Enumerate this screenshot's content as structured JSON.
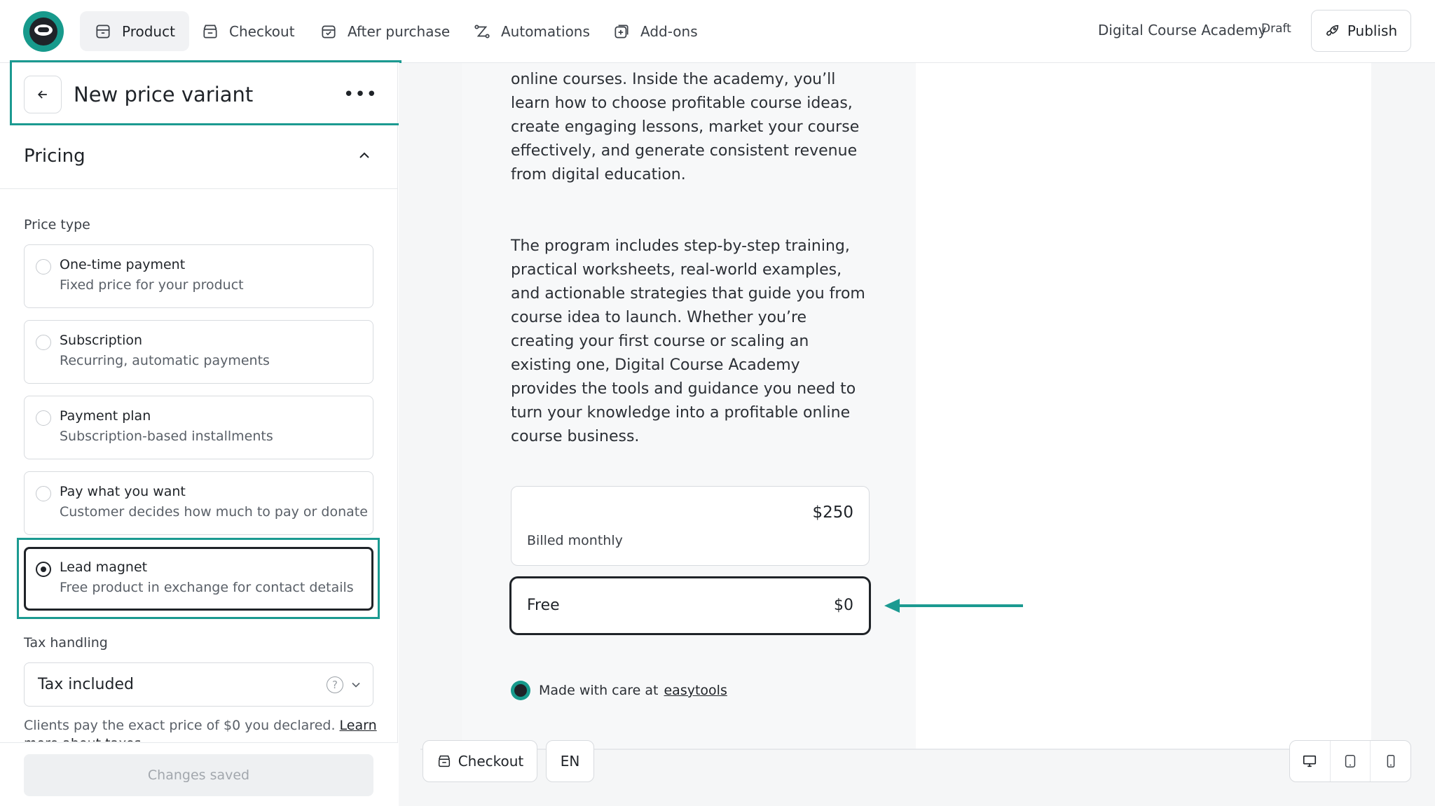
{
  "nav": {
    "items": [
      {
        "label": "Product",
        "icon": "product-box-icon",
        "active": true
      },
      {
        "label": "Checkout",
        "icon": "checkout-icon",
        "active": false
      },
      {
        "label": "After purchase",
        "icon": "after-purchase-icon",
        "active": false
      },
      {
        "label": "Automations",
        "icon": "automations-icon",
        "active": false
      },
      {
        "label": "Add-ons",
        "icon": "add-ons-icon",
        "active": false
      }
    ],
    "course_name": "Digital Course Academy",
    "status_badge": "Draft",
    "publish_label": "Publish"
  },
  "sidebar": {
    "variant_title": "New price variant",
    "section_title": "Pricing",
    "price_type_label": "Price type",
    "options": [
      {
        "title": "One-time payment",
        "desc": "Fixed price for your product",
        "selected": false
      },
      {
        "title": "Subscription",
        "desc": "Recurring, automatic payments",
        "selected": false
      },
      {
        "title": "Payment plan",
        "desc": "Subscription-based installments",
        "selected": false
      },
      {
        "title": "Pay what you want",
        "desc": "Customer decides how much to pay or donate",
        "selected": false
      },
      {
        "title": "Lead magnet",
        "desc": "Free product in exchange for contact details",
        "selected": true
      }
    ],
    "tax_label": "Tax handling",
    "tax_value": "Tax included",
    "tax_help": "Clients pay the exact price of $0 you declared.",
    "tax_link": "Learn more about taxes",
    "saved_label": "Changes saved"
  },
  "preview": {
    "para1": "online courses. Inside the academy, you’ll learn how to choose profitable course ideas, create engaging lessons, market your course effectively, and generate consistent revenue from digital education.",
    "para2": "The program includes step-by-step training, practical worksheets, real-world examples, and actionable strategies that guide you from course idea to launch. Whether you’re creating your first course or scaling an existing one, Digital Course Academy provides the tools and guidance you need to turn your knowledge into a profitable online course business.",
    "price_card": {
      "amount": "$250",
      "billing": "Billed monthly"
    },
    "free_card": {
      "name": "Free",
      "amount": "$0"
    },
    "made_with": "Made with care at",
    "made_with_link": "easytools"
  },
  "toolbar": {
    "checkout_label": "Checkout",
    "language": "EN",
    "devices": [
      "desktop-icon",
      "tablet-icon",
      "mobile-icon"
    ]
  },
  "colors": {
    "accent_teal": "#1b9a91",
    "dark": "#1f2328"
  }
}
